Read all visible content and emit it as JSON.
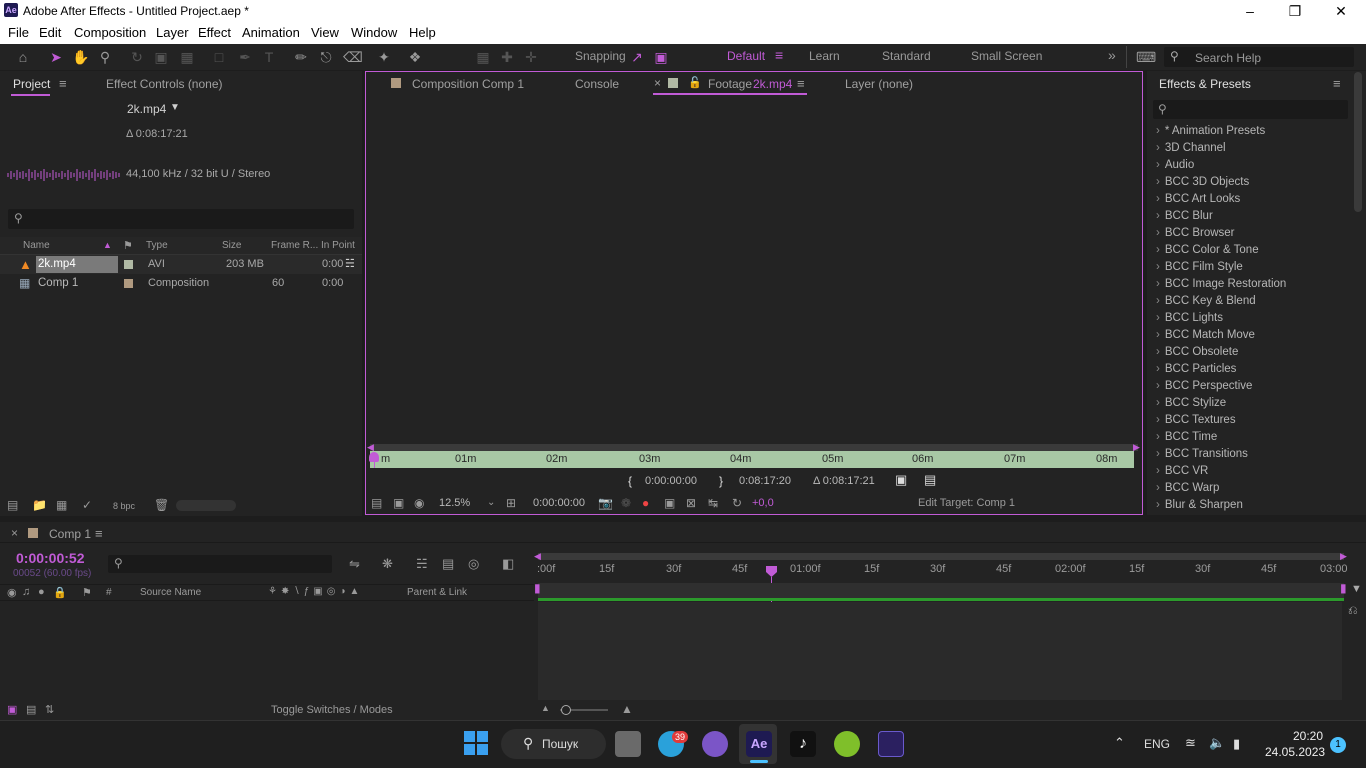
{
  "window": {
    "title": "Adobe After Effects - Untitled Project.aep *",
    "app_badge": "Ae"
  },
  "menu": [
    "File",
    "Edit",
    "Composition",
    "Layer",
    "Effect",
    "Animation",
    "View",
    "Window",
    "Help"
  ],
  "toolbar": {
    "snapping_label": "Snapping",
    "workspaces": [
      "Default",
      "Learn",
      "Standard",
      "Small Screen"
    ],
    "search_placeholder": "Search Help"
  },
  "project_panel": {
    "tab_project": "Project",
    "tab_effect_controls": "Effect Controls (none)",
    "footage_name": "2k.mp4",
    "footage_duration": "Δ 0:08:17:21",
    "audio_info": "44,100 kHz / 32 bit U / Stereo",
    "columns": [
      "Name",
      "Type",
      "Size",
      "Frame R...",
      "In Point"
    ],
    "rows": [
      {
        "name": "2k.mp4",
        "type": "AVI",
        "size": "203 MB",
        "frame_rate": "",
        "in_point": "0:00"
      },
      {
        "name": "Comp 1",
        "type": "Composition",
        "size": "",
        "frame_rate": "60",
        "in_point": "0:00"
      }
    ],
    "bpc": "8 bpc"
  },
  "viewer": {
    "tabs": [
      "Composition Comp 1",
      "Console",
      "Footage",
      "2k.mp4",
      "Layer (none)"
    ],
    "ruler_labels": [
      "m",
      "01m",
      "02m",
      "03m",
      "04m",
      "05m",
      "06m",
      "07m",
      "08m"
    ],
    "in_time": "0:00:00:00",
    "out_time": "0:08:17:20",
    "duration": "Δ 0:08:17:21",
    "zoom": "12.5%",
    "current_time": "0:00:00:00",
    "exposure": "+0,0",
    "edit_target": "Edit Target: Comp 1"
  },
  "effects_panel": {
    "title": "Effects & Presets",
    "items": [
      "* Animation Presets",
      "3D Channel",
      "Audio",
      "BCC 3D Objects",
      "BCC Art Looks",
      "BCC Blur",
      "BCC Browser",
      "BCC Color & Tone",
      "BCC Film Style",
      "BCC Image Restoration",
      "BCC Key & Blend",
      "BCC Lights",
      "BCC Match Move",
      "BCC Obsolete",
      "BCC Particles",
      "BCC Perspective",
      "BCC Stylize",
      "BCC Textures",
      "BCC Time",
      "BCC Transitions",
      "BCC VR",
      "BCC Warp",
      "Blur & Sharpen"
    ]
  },
  "timeline": {
    "tab": "Comp 1",
    "timecode": "0:00:00:52",
    "frame_info": "00052 (60.00 fps)",
    "col_source": "Source Name",
    "col_parent": "Parent & Link",
    "ticks": [
      ":00f",
      "15f",
      "30f",
      "45f",
      "01:00f",
      "15f",
      "30f",
      "45f",
      "02:00f",
      "15f",
      "30f",
      "45f",
      "03:00"
    ],
    "toggle_label": "Toggle Switches / Modes"
  },
  "taskbar": {
    "search_label": "Пошук",
    "telegram_badge": "39",
    "lang": "ENG",
    "time": "20:20",
    "date": "24.05.2023",
    "notification_count": "1"
  },
  "colors": {
    "accent": "#c15bd6",
    "panel": "#232323",
    "bg": "#1d1d1d",
    "ruler": "#a8c8a5"
  }
}
